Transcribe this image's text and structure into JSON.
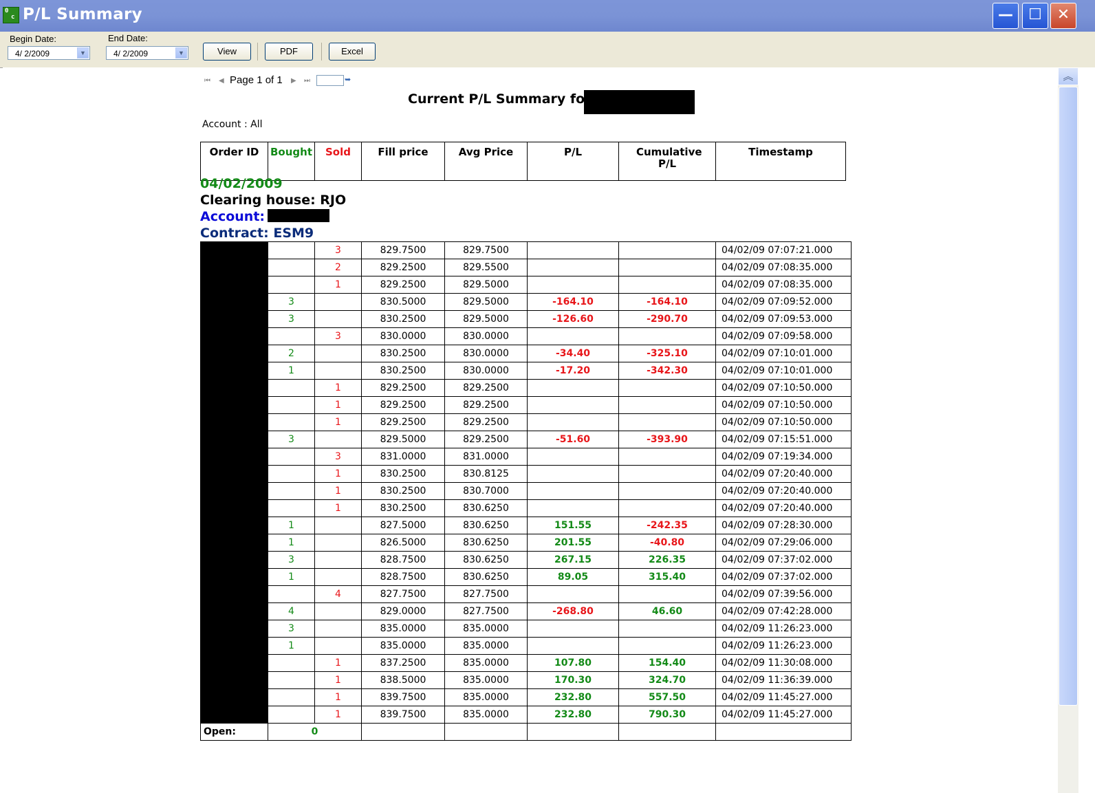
{
  "window": {
    "title": "P/L Summary",
    "min": "—",
    "max": "☐",
    "close": "✕"
  },
  "toolbar": {
    "begin_label": "Begin Date:",
    "begin_value": "4/ 2/2009",
    "end_label": "End Date:",
    "end_value": "4/ 2/2009",
    "view": "View",
    "pdf": "PDF",
    "excel": "Excel"
  },
  "pager": {
    "text": "Page 1 of 1"
  },
  "report": {
    "title": "Current P/L Summary for",
    "account_filter": "Account : All",
    "date": "04/02/2009",
    "clearing_house": "Clearing house: RJO",
    "account_label": "Account:",
    "contract": "Contract: ESM9",
    "open_label": "Open:",
    "open_value": "0"
  },
  "columns": [
    "Order ID",
    "Bought",
    "Sold",
    "Fill price",
    "Avg Price",
    "P/L",
    "Cumulative P/L",
    "Timestamp"
  ],
  "rows": [
    {
      "b": "",
      "s": "3",
      "fill": "829.7500",
      "avg": "829.7500",
      "pl": "",
      "cum": "",
      "ts": "04/02/09 07:07:21.000",
      "plc": "",
      "cumc": ""
    },
    {
      "b": "",
      "s": "2",
      "fill": "829.2500",
      "avg": "829.5500",
      "pl": "",
      "cum": "",
      "ts": "04/02/09 07:08:35.000",
      "plc": "",
      "cumc": ""
    },
    {
      "b": "",
      "s": "1",
      "fill": "829.2500",
      "avg": "829.5000",
      "pl": "",
      "cum": "",
      "ts": "04/02/09 07:08:35.000",
      "plc": "",
      "cumc": ""
    },
    {
      "b": "3",
      "s": "",
      "fill": "830.5000",
      "avg": "829.5000",
      "pl": "-164.10",
      "cum": "-164.10",
      "ts": "04/02/09 07:09:52.000",
      "plc": "red",
      "cumc": "red"
    },
    {
      "b": "3",
      "s": "",
      "fill": "830.2500",
      "avg": "829.5000",
      "pl": "-126.60",
      "cum": "-290.70",
      "ts": "04/02/09 07:09:53.000",
      "plc": "red",
      "cumc": "red"
    },
    {
      "b": "",
      "s": "3",
      "fill": "830.0000",
      "avg": "830.0000",
      "pl": "",
      "cum": "",
      "ts": "04/02/09 07:09:58.000",
      "plc": "",
      "cumc": ""
    },
    {
      "b": "2",
      "s": "",
      "fill": "830.2500",
      "avg": "830.0000",
      "pl": "-34.40",
      "cum": "-325.10",
      "ts": "04/02/09 07:10:01.000",
      "plc": "red",
      "cumc": "red"
    },
    {
      "b": "1",
      "s": "",
      "fill": "830.2500",
      "avg": "830.0000",
      "pl": "-17.20",
      "cum": "-342.30",
      "ts": "04/02/09 07:10:01.000",
      "plc": "red",
      "cumc": "red"
    },
    {
      "b": "",
      "s": "1",
      "fill": "829.2500",
      "avg": "829.2500",
      "pl": "",
      "cum": "",
      "ts": "04/02/09 07:10:50.000",
      "plc": "",
      "cumc": ""
    },
    {
      "b": "",
      "s": "1",
      "fill": "829.2500",
      "avg": "829.2500",
      "pl": "",
      "cum": "",
      "ts": "04/02/09 07:10:50.000",
      "plc": "",
      "cumc": ""
    },
    {
      "b": "",
      "s": "1",
      "fill": "829.2500",
      "avg": "829.2500",
      "pl": "",
      "cum": "",
      "ts": "04/02/09 07:10:50.000",
      "plc": "",
      "cumc": ""
    },
    {
      "b": "3",
      "s": "",
      "fill": "829.5000",
      "avg": "829.2500",
      "pl": "-51.60",
      "cum": "-393.90",
      "ts": "04/02/09 07:15:51.000",
      "plc": "red",
      "cumc": "red"
    },
    {
      "b": "",
      "s": "3",
      "fill": "831.0000",
      "avg": "831.0000",
      "pl": "",
      "cum": "",
      "ts": "04/02/09 07:19:34.000",
      "plc": "",
      "cumc": ""
    },
    {
      "b": "",
      "s": "1",
      "fill": "830.2500",
      "avg": "830.8125",
      "pl": "",
      "cum": "",
      "ts": "04/02/09 07:20:40.000",
      "plc": "",
      "cumc": ""
    },
    {
      "b": "",
      "s": "1",
      "fill": "830.2500",
      "avg": "830.7000",
      "pl": "",
      "cum": "",
      "ts": "04/02/09 07:20:40.000",
      "plc": "",
      "cumc": ""
    },
    {
      "b": "",
      "s": "1",
      "fill": "830.2500",
      "avg": "830.6250",
      "pl": "",
      "cum": "",
      "ts": "04/02/09 07:20:40.000",
      "plc": "",
      "cumc": ""
    },
    {
      "b": "1",
      "s": "",
      "fill": "827.5000",
      "avg": "830.6250",
      "pl": "151.55",
      "cum": "-242.35",
      "ts": "04/02/09 07:28:30.000",
      "plc": "green",
      "cumc": "red"
    },
    {
      "b": "1",
      "s": "",
      "fill": "826.5000",
      "avg": "830.6250",
      "pl": "201.55",
      "cum": "-40.80",
      "ts": "04/02/09 07:29:06.000",
      "plc": "green",
      "cumc": "red"
    },
    {
      "b": "3",
      "s": "",
      "fill": "828.7500",
      "avg": "830.6250",
      "pl": "267.15",
      "cum": "226.35",
      "ts": "04/02/09 07:37:02.000",
      "plc": "green",
      "cumc": "green"
    },
    {
      "b": "1",
      "s": "",
      "fill": "828.7500",
      "avg": "830.6250",
      "pl": "89.05",
      "cum": "315.40",
      "ts": "04/02/09 07:37:02.000",
      "plc": "green",
      "cumc": "green"
    },
    {
      "b": "",
      "s": "4",
      "fill": "827.7500",
      "avg": "827.7500",
      "pl": "",
      "cum": "",
      "ts": "04/02/09 07:39:56.000",
      "plc": "",
      "cumc": ""
    },
    {
      "b": "4",
      "s": "",
      "fill": "829.0000",
      "avg": "827.7500",
      "pl": "-268.80",
      "cum": "46.60",
      "ts": "04/02/09 07:42:28.000",
      "plc": "red",
      "cumc": "green"
    },
    {
      "b": "3",
      "s": "",
      "fill": "835.0000",
      "avg": "835.0000",
      "pl": "",
      "cum": "",
      "ts": "04/02/09 11:26:23.000",
      "plc": "",
      "cumc": ""
    },
    {
      "b": "1",
      "s": "",
      "fill": "835.0000",
      "avg": "835.0000",
      "pl": "",
      "cum": "",
      "ts": "04/02/09 11:26:23.000",
      "plc": "",
      "cumc": ""
    },
    {
      "b": "",
      "s": "1",
      "fill": "837.2500",
      "avg": "835.0000",
      "pl": "107.80",
      "cum": "154.40",
      "ts": "04/02/09 11:30:08.000",
      "plc": "green",
      "cumc": "green"
    },
    {
      "b": "",
      "s": "1",
      "fill": "838.5000",
      "avg": "835.0000",
      "pl": "170.30",
      "cum": "324.70",
      "ts": "04/02/09 11:36:39.000",
      "plc": "green",
      "cumc": "green"
    },
    {
      "b": "",
      "s": "1",
      "fill": "839.7500",
      "avg": "835.0000",
      "pl": "232.80",
      "cum": "557.50",
      "ts": "04/02/09 11:45:27.000",
      "plc": "green",
      "cumc": "green"
    },
    {
      "b": "",
      "s": "1",
      "fill": "839.7500",
      "avg": "835.0000",
      "pl": "232.80",
      "cum": "790.30",
      "ts": "04/02/09 11:45:27.000",
      "plc": "green",
      "cumc": "green"
    }
  ]
}
